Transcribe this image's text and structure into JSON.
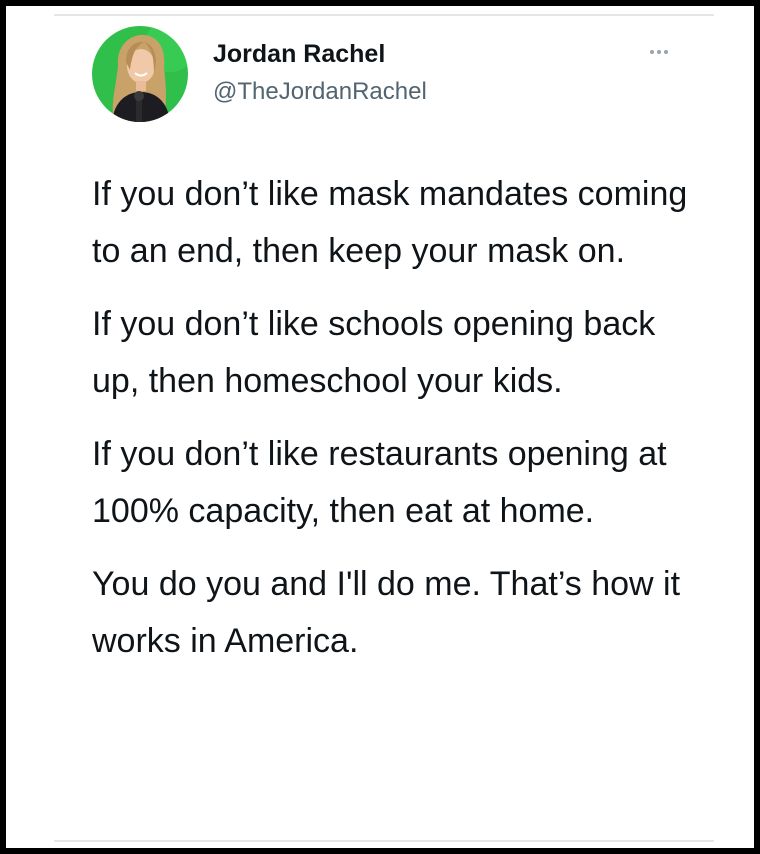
{
  "tweet": {
    "author": {
      "display_name": "Jordan Rachel",
      "handle": "@TheJordanRachel",
      "avatar_icon": "profile-photo",
      "avatar_background": "#2fbf4a"
    },
    "more_icon": "more-options-icon",
    "paragraphs": [
      "If you don’t like mask mandates coming to an end, then keep your mask on.",
      "If you don’t like schools opening back up, then homeschool your kids.",
      "If you don’t like restaurants opening at 100% capacity, then eat at home.",
      "You do you and I'll do me. That’s how it works in America."
    ]
  }
}
